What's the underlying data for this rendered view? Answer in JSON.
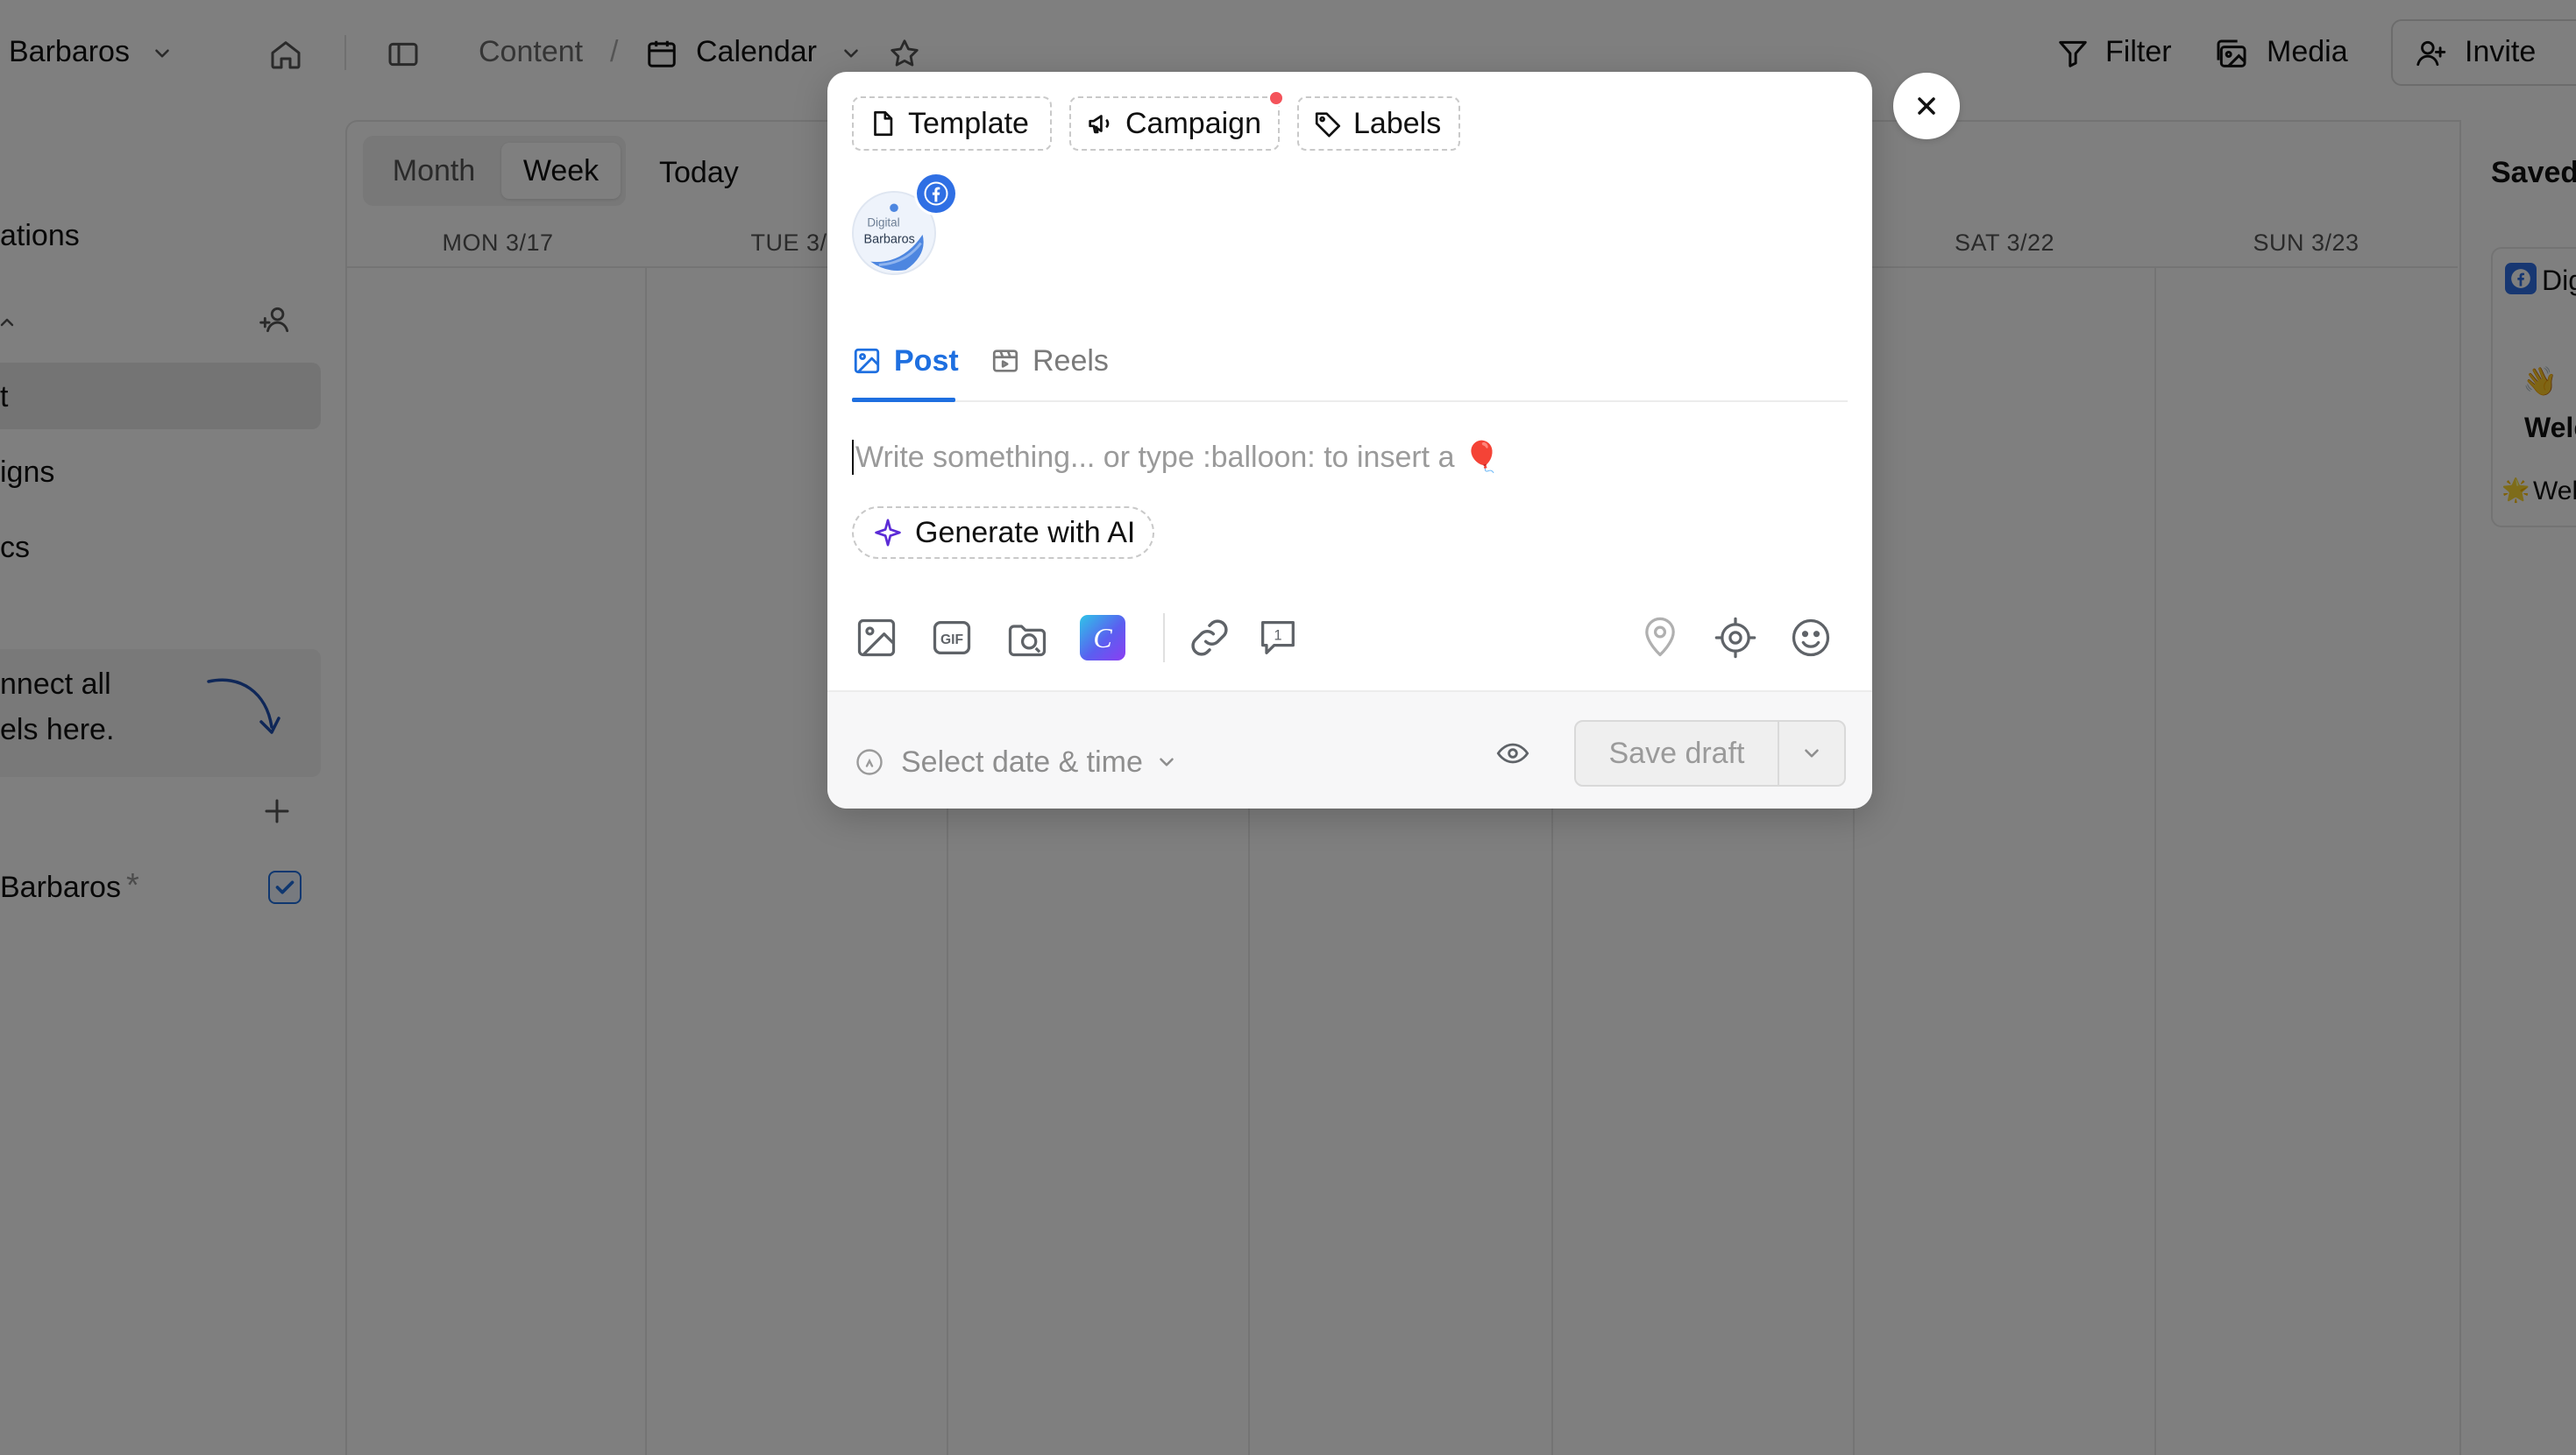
{
  "topbar": {
    "workspace": "Barbaros",
    "breadcrumb_content": "Content",
    "breadcrumb_separator": "/",
    "breadcrumb_calendar": "Calendar",
    "filter_label": "Filter",
    "media_label": "Media",
    "invite_label": "Invite"
  },
  "sidebar": {
    "section_label": "ations",
    "items": [
      {
        "label": "t"
      },
      {
        "label": "igns"
      },
      {
        "label": "cs"
      }
    ],
    "promo_line1": "nnect all",
    "promo_line2": "els here.",
    "channel_name": "Barbaros",
    "channel_asterisk": "*"
  },
  "calendar": {
    "views": {
      "month": "Month",
      "week": "Week"
    },
    "today_label": "Today",
    "days": [
      "MON 3/17",
      "TUE 3/",
      "SAT 3/22",
      "SUN 3/23"
    ]
  },
  "saved_panel": {
    "title": "Saved",
    "card_page_label": "Dig",
    "card_emoji": "👋",
    "card_title": "Welc",
    "card_subtitle": "Wel",
    "card_sub_emoji": "🌟"
  },
  "modal": {
    "chips": {
      "template": "Template",
      "campaign": "Campaign",
      "labels": "Labels"
    },
    "avatar_text_line1": "Digital",
    "avatar_text_line2": "Barbaros",
    "tabs": {
      "post": "Post",
      "reels": "Reels"
    },
    "editor_placeholder": "Write something... or type :balloon: to insert a",
    "editor_emoji": "🎈",
    "generate_ai": "Generate with AI",
    "toolbar_icons": [
      "image-icon",
      "gif-icon",
      "media-library-icon",
      "canva-icon",
      "link-icon",
      "first-comment-icon",
      "location-icon",
      "target-icon",
      "emoji-icon"
    ],
    "first_comment_count": "1",
    "canva_letter": "C",
    "date_select": "Select date & time",
    "save_draft": "Save draft"
  },
  "colors": {
    "accent": "#1e6fe0",
    "facebook": "#2f6fe4",
    "notification": "#f4535a",
    "overlay": "rgba(0,0,0,0.5)"
  }
}
